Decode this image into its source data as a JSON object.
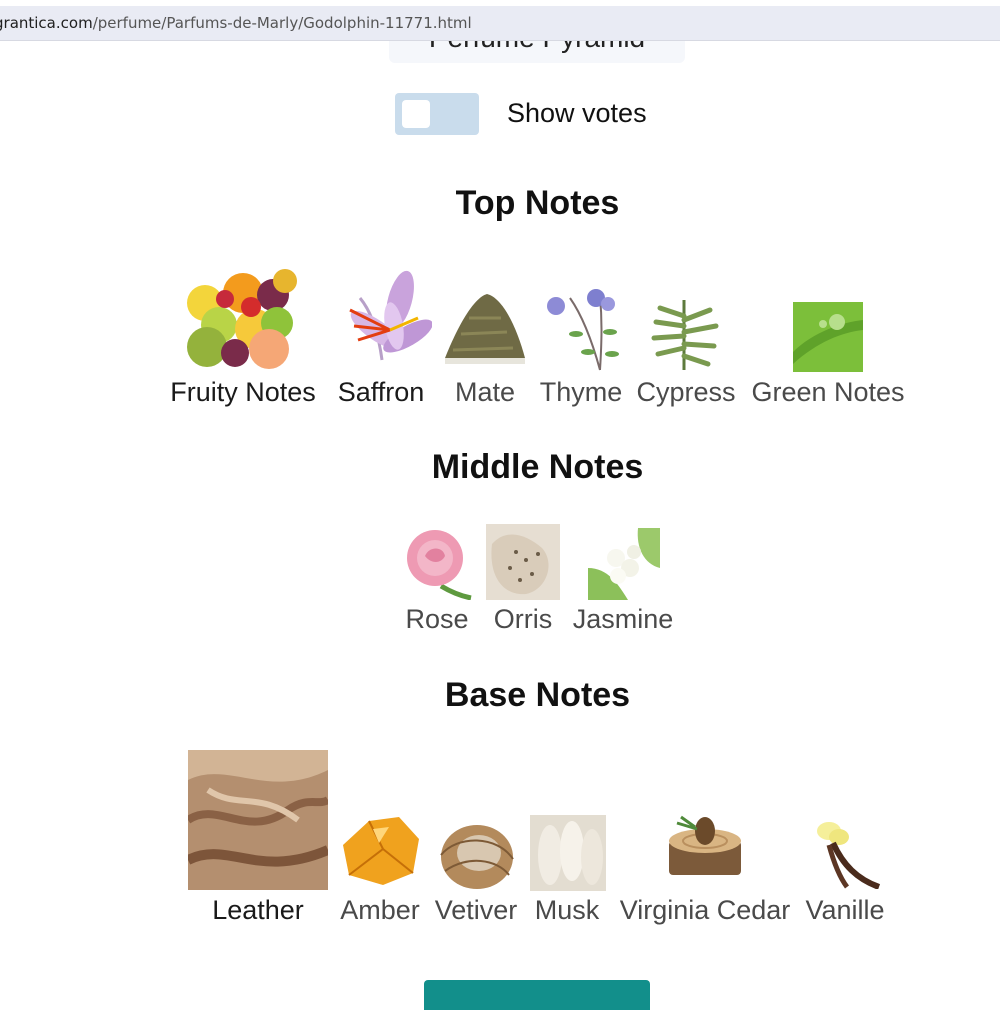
{
  "browser": {
    "url_host": "grantica.com",
    "url_path": "/perfume/Parfums-de-Marly/Godolphin-11771.html"
  },
  "page": {
    "pyramid_title": "Perfume Pyramid",
    "show_votes_label": "Show votes"
  },
  "sections": {
    "top": {
      "title": "Top Notes",
      "notes": [
        {
          "name": "Fruity Notes",
          "icon": "fruit-image"
        },
        {
          "name": "Saffron",
          "icon": "saffron-flower-image"
        },
        {
          "name": "Mate",
          "icon": "mate-leaves-image"
        },
        {
          "name": "Thyme",
          "icon": "thyme-flower-image"
        },
        {
          "name": "Cypress",
          "icon": "cypress-branch-image"
        },
        {
          "name": "Green Notes",
          "icon": "green-leaf-image"
        }
      ]
    },
    "middle": {
      "title": "Middle Notes",
      "notes": [
        {
          "name": "Rose",
          "icon": "rose-image"
        },
        {
          "name": "Orris",
          "icon": "orris-root-image"
        },
        {
          "name": "Jasmine",
          "icon": "jasmine-image"
        }
      ]
    },
    "base": {
      "title": "Base Notes",
      "notes": [
        {
          "name": "Leather",
          "icon": "leather-image"
        },
        {
          "name": "Amber",
          "icon": "amber-image"
        },
        {
          "name": "Vetiver",
          "icon": "vetiver-image"
        },
        {
          "name": "Musk",
          "icon": "musk-image"
        },
        {
          "name": "Virginia Cedar",
          "icon": "cedar-image"
        },
        {
          "name": "Vanille",
          "icon": "vanilla-image"
        }
      ]
    }
  },
  "colors": {
    "toggle_bg": "#c9dcec",
    "button_bg": "#128f8b",
    "url_bar_bg": "#e9ebf4"
  }
}
